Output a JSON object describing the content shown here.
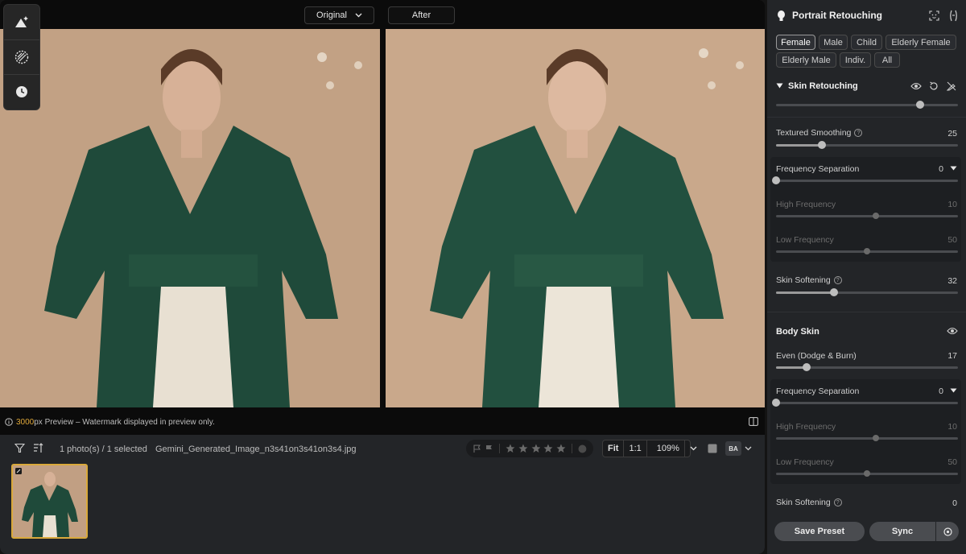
{
  "compare": {
    "original_label": "Original",
    "after_label": "After"
  },
  "preview": {
    "px_value": "3000",
    "px_unit": "px",
    "text": "Preview – Watermark displayed in preview only."
  },
  "filmstrip": {
    "selected_text": "1 photo(s) / 1 selected",
    "filename": "Gemini_Generated_Image_n3s41on3s41on3s4.jpg",
    "rating_stars": 0,
    "zoom": {
      "fit_label": "Fit",
      "one_to_one_label": "1:1",
      "zoom_value": "109%"
    },
    "view_label": "BA"
  },
  "panel": {
    "title": "Portrait Retouching",
    "presets": [
      "Female",
      "Male",
      "Child",
      "Elderly Female",
      "Elderly Male",
      "Indiv.",
      "All"
    ],
    "active_preset": "Female",
    "skin_section": {
      "title": "Skin Retouching",
      "textured_smoothing": {
        "label": "Textured Smoothing",
        "value": "25",
        "level": 0.25
      },
      "freq_sep": {
        "label": "Frequency Separation",
        "value": "0",
        "level": 0
      },
      "high_freq": {
        "label": "High Frequency",
        "value": "10",
        "level": 0.55
      },
      "low_freq": {
        "label": "Low Frequency",
        "value": "50",
        "level": 0.5
      },
      "skin_softening": {
        "label": "Skin Softening",
        "value": "32",
        "level": 0.32
      }
    },
    "body_section": {
      "title": "Body Skin",
      "even": {
        "label": "Even (Dodge & Burn)",
        "value": "17",
        "level": 0.17
      },
      "freq_sep": {
        "label": "Frequency Separation",
        "value": "0",
        "level": 0
      },
      "high_freq": {
        "label": "High Frequency",
        "value": "10",
        "level": 0.55
      },
      "low_freq": {
        "label": "Low Frequency",
        "value": "50",
        "level": 0.5
      },
      "skin_softening": {
        "label": "Skin Softening",
        "value": "0",
        "level": 0
      }
    },
    "footer": {
      "save_label": "Save Preset",
      "sync_label": "Sync"
    }
  },
  "colors": {
    "accent_gold": "#d9a93b",
    "panel_bg": "#232528",
    "wall": "#c9a78a",
    "coat": "#1f4a3a"
  }
}
